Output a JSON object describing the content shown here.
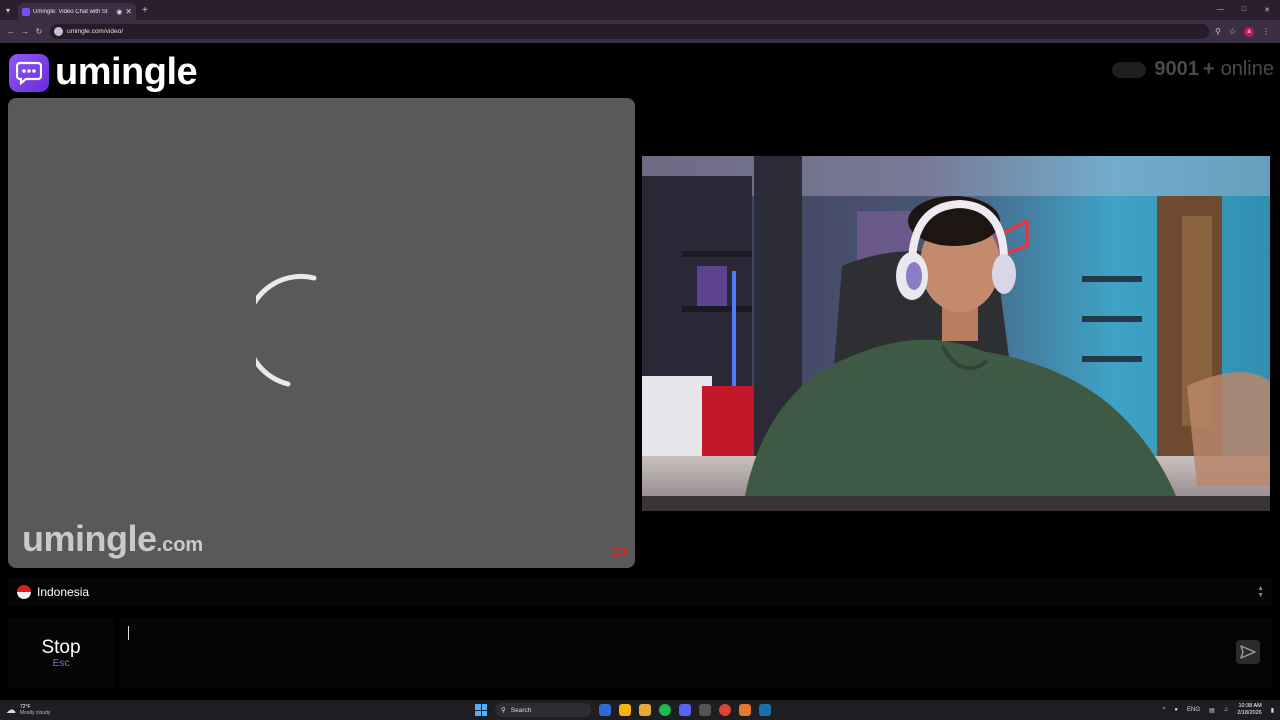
{
  "browser": {
    "tab_title": "Umingle: Video Chat with St",
    "url": "umingle.com/video/",
    "profile_initial": "a"
  },
  "header": {
    "logo_text": "umingle",
    "online_count": "9001",
    "online_plus": "+",
    "online_label": "online"
  },
  "stranger_video": {
    "watermark_main": "umingle",
    "watermark_domain": ".com"
  },
  "country": {
    "name": "Indonesia"
  },
  "controls": {
    "stop_label": "Stop",
    "stop_hint": "Esc",
    "chat_value": "",
    "chat_placeholder": ""
  },
  "taskbar": {
    "weather_temp": "72°F",
    "weather_desc": "Mostly cloudy",
    "search_label": "Search",
    "lang": "ENG",
    "time": "10:38 AM",
    "date": "2/18/2026"
  },
  "colors": {
    "brand": "#7c3aed",
    "stranger_bg": "#585958",
    "flag_red": "#e0201e"
  }
}
